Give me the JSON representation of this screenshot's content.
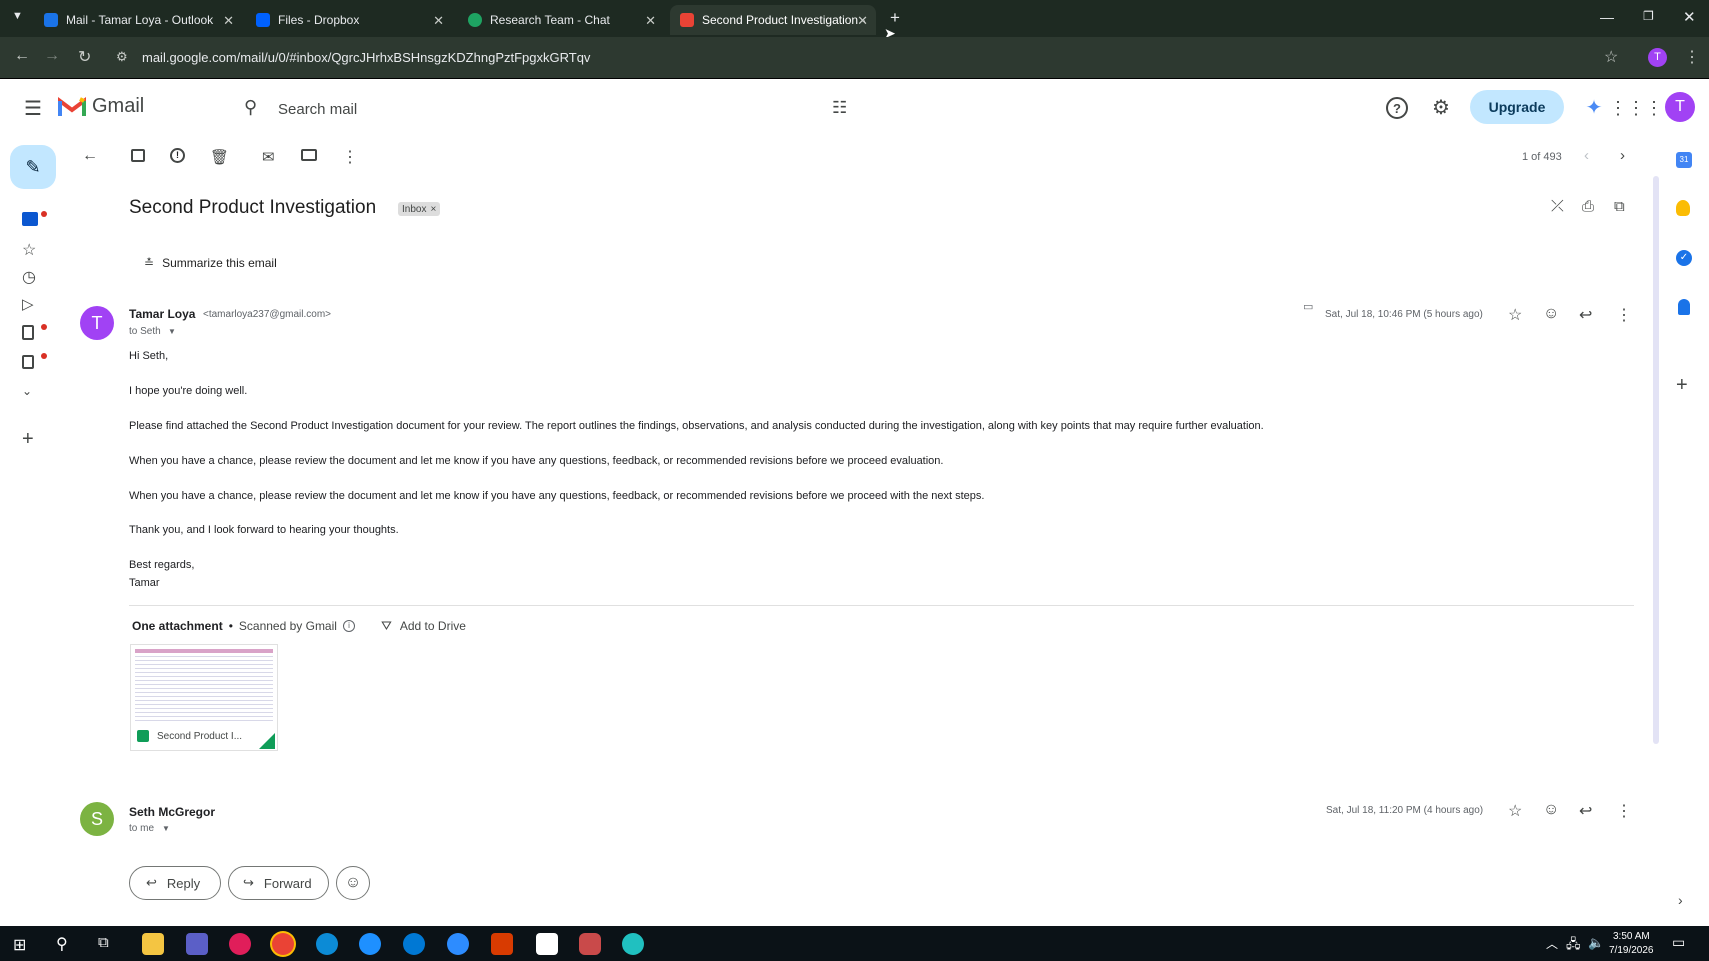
{
  "browser": {
    "tabs": [
      {
        "label": "Mail - Tamar Loya - Outlook",
        "color": "#1a73e8"
      },
      {
        "label": "Files - Dropbox",
        "color": "#0061fe"
      },
      {
        "label": "Research Team - Chat",
        "color": "#1ea362"
      },
      {
        "label": "Second Product Investigation -",
        "color": "#ea4335"
      }
    ],
    "url": "mail.google.com/mail/u/0/#inbox/QgrcJHrhxBSHnsgzKDZhngPztFpgxkGRTqv",
    "profile_initial": "T"
  },
  "gmail": {
    "logo_text": "Gmail",
    "search_placeholder": "Search mail",
    "upgrade_label": "Upgrade",
    "avatar_initial": "T",
    "pager": "1 of 493"
  },
  "thread": {
    "subject": "Second Product Investigation",
    "label": "Inbox",
    "label_close": "×",
    "summarize": "Summarize this email",
    "messages": [
      {
        "sender_initial": "T",
        "sender_name": "Tamar Loya",
        "sender_email": "<tamarloya237@gmail.com>",
        "to": "to Seth",
        "date": "Sat, Jul 18, 10:46 PM (5 hours ago)",
        "body": [
          "Hi Seth,",
          "I hope you're doing well.",
          "Please find attached the Second Product Investigation document for your review. The report outlines the findings, observations, and analysis conducted during the investigation, along with key points that may require further evaluation.",
          "When you have a chance, please review the document and let me know if you have any questions, feedback, or recommended revisions before we proceed evaluation.",
          "When you have a chance, please review the document and let me know if you have any questions, feedback, or recommended revisions before we proceed with the next steps.",
          "Thank you, and I look forward to hearing your thoughts.",
          "Best regards,",
          "Tamar"
        ],
        "attachment_header": "One attachment",
        "scanned": "Scanned by Gmail",
        "add_to_drive": "Add to Drive",
        "attachment_name": "Second Product I..."
      },
      {
        "sender_initial": "S",
        "sender_name": "Seth McGregor",
        "to": "to me",
        "date": "Sat, Jul 18, 11:20 PM (4 hours ago)"
      }
    ],
    "reply_label": "Reply",
    "forward_label": "Forward"
  },
  "taskbar": {
    "time": "3:50 AM",
    "date": "7/19/2026"
  }
}
